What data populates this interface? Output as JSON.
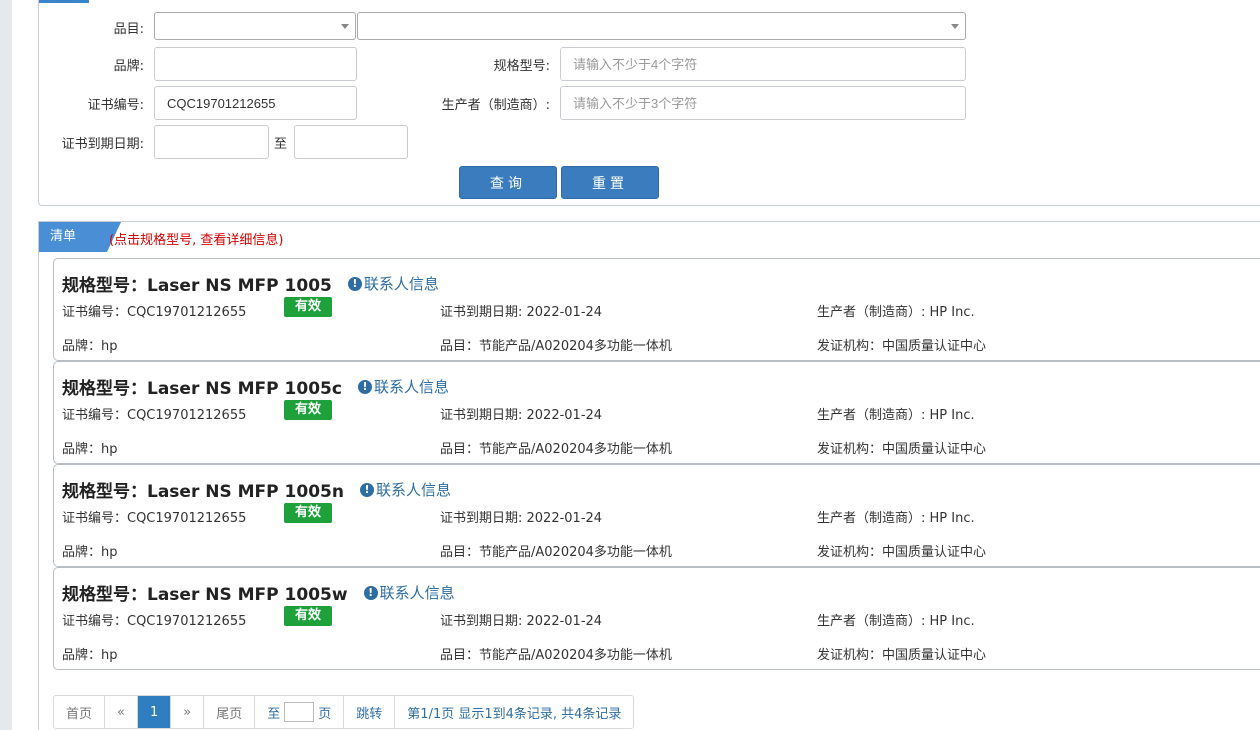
{
  "search": {
    "category_label": "品目:",
    "brand_label": "品牌:",
    "model_label": "规格型号:",
    "model_placeholder": "请输入不少于4个字符",
    "cert_label": "证书编号:",
    "cert_value": "CQC19701212655",
    "maker_label": "生产者（制造商）:",
    "maker_placeholder": "请输入不少于3个字符",
    "expiry_label": "证书到期日期:",
    "expiry_to": "至",
    "query_button": "查询",
    "reset_button": "重置"
  },
  "list": {
    "tab": "清单",
    "hint": "(点击规格型号, 查看详细信息)",
    "contact_label": "联系人信息",
    "items": [
      {
        "title": "规格型号：Laser NS MFP 1005",
        "cert": "证书编号：CQC19701212655",
        "status": "有效",
        "expiry": "证书到期日期: 2022-01-24",
        "maker": "生产者（制造商）: HP Inc.",
        "brand": "品牌：hp",
        "category": "品目：节能产品/A020204多功能一体机",
        "issuer": "发证机构：中国质量认证中心"
      },
      {
        "title": "规格型号：Laser NS MFP 1005c",
        "cert": "证书编号：CQC19701212655",
        "status": "有效",
        "expiry": "证书到期日期: 2022-01-24",
        "maker": "生产者（制造商）: HP Inc.",
        "brand": "品牌：hp",
        "category": "品目：节能产品/A020204多功能一体机",
        "issuer": "发证机构：中国质量认证中心"
      },
      {
        "title": "规格型号：Laser NS MFP 1005n",
        "cert": "证书编号：CQC19701212655",
        "status": "有效",
        "expiry": "证书到期日期: 2022-01-24",
        "maker": "生产者（制造商）: HP Inc.",
        "brand": "品牌：hp",
        "category": "品目：节能产品/A020204多功能一体机",
        "issuer": "发证机构：中国质量认证中心"
      },
      {
        "title": "规格型号：Laser NS MFP 1005w",
        "cert": "证书编号：CQC19701212655",
        "status": "有效",
        "expiry": "证书到期日期: 2022-01-24",
        "maker": "生产者（制造商）: HP Inc.",
        "brand": "品牌：hp",
        "category": "品目：节能产品/A020204多功能一体机",
        "issuer": "发证机构：中国质量认证中心"
      }
    ]
  },
  "pager": {
    "first": "首页",
    "prev": "«",
    "current": "1",
    "next": "»",
    "last": "尾页",
    "goto_prefix": "至",
    "goto_suffix": "页",
    "jump": "跳转",
    "summary": "第1/1页  显示1到4条记录, 共4条记录"
  },
  "colors": {
    "accent": "#3a7cbd",
    "valid": "#1ea03b",
    "hint": "#d40000"
  }
}
